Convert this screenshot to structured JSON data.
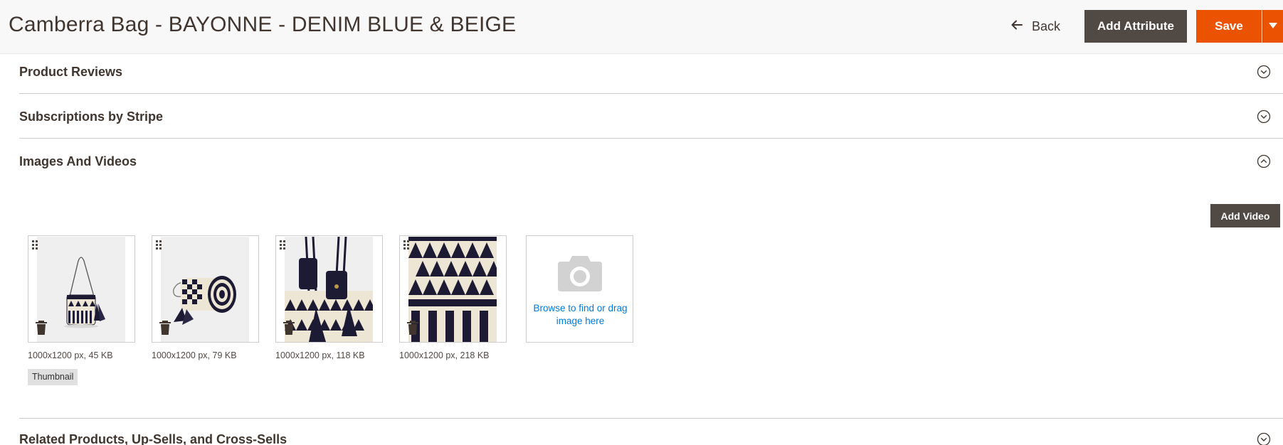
{
  "header": {
    "title": "Camberra Bag - BAYONNE - DENIM BLUE & BEIGE",
    "back_label": "Back",
    "add_attribute_label": "Add Attribute",
    "save_label": "Save"
  },
  "sections": [
    {
      "title": "Product Reviews",
      "state": "collapsed"
    },
    {
      "title": "Subscriptions by Stripe",
      "state": "collapsed"
    },
    {
      "title": "Images And Videos",
      "state": "expanded"
    },
    {
      "title": "Related Products, Up-Sells, and Cross-Sells",
      "state": "collapsed"
    }
  ],
  "images_videos": {
    "add_video_label": "Add Video",
    "images": [
      {
        "meta": "1000x1200 px, 45 KB",
        "role": "Thumbnail"
      },
      {
        "meta": "1000x1200 px, 79 KB"
      },
      {
        "meta": "1000x1200 px, 118 KB"
      },
      {
        "meta": "1000x1200 px, 218 KB"
      }
    ],
    "upload_label": "Browse to find or drag image here"
  },
  "colors": {
    "primary_action": "#eb5202",
    "secondary_action": "#514943",
    "link": "#007bdb",
    "product_navy": "#1d1b33",
    "product_beige": "#eee6d4"
  },
  "icons": {
    "back": "arrow-left-icon",
    "save_toggle": "caret-down-icon",
    "collapsed": "chevron-down-circle-icon",
    "expanded": "chevron-up-circle-icon",
    "drag": "drag-handle-icon",
    "delete": "trash-icon",
    "upload": "camera-icon"
  }
}
